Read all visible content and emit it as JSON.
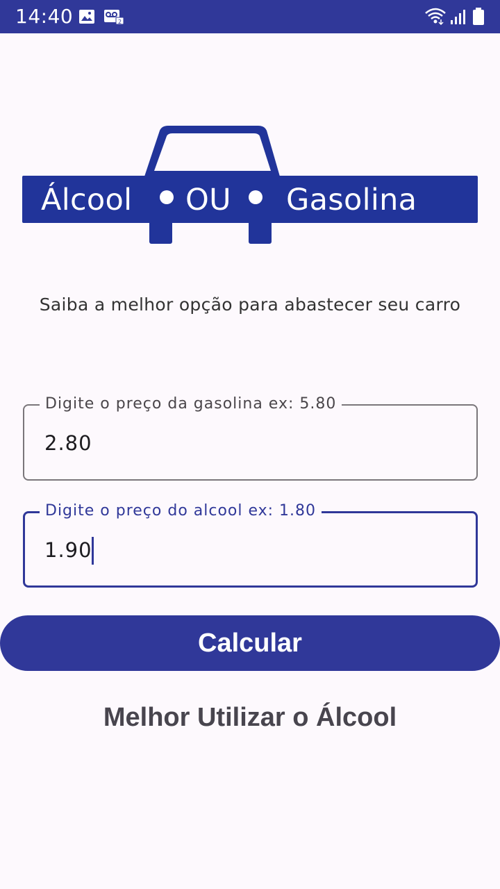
{
  "status_bar": {
    "time": "14:40",
    "icons": [
      "image-icon",
      "voicemail-icon",
      "wifi-icon",
      "signal-icon",
      "battery-icon"
    ],
    "background_color": "#303899"
  },
  "logo": {
    "word_left": "Álcool",
    "word_middle": "OU",
    "word_right": "Gasolina",
    "color": "#21349a"
  },
  "subtitle": "Saiba a melhor opção para abastecer seu carro",
  "fields": {
    "gasoline": {
      "label": "Digite o preço da gasolina ex: 5.80",
      "value": "2.80"
    },
    "alcohol": {
      "label": "Digite o preço do alcool ex: 1.80",
      "value": "1.90",
      "focused": true
    }
  },
  "button": {
    "label": "Calcular",
    "color": "#303899"
  },
  "result": "Melhor Utilizar o Álcool"
}
